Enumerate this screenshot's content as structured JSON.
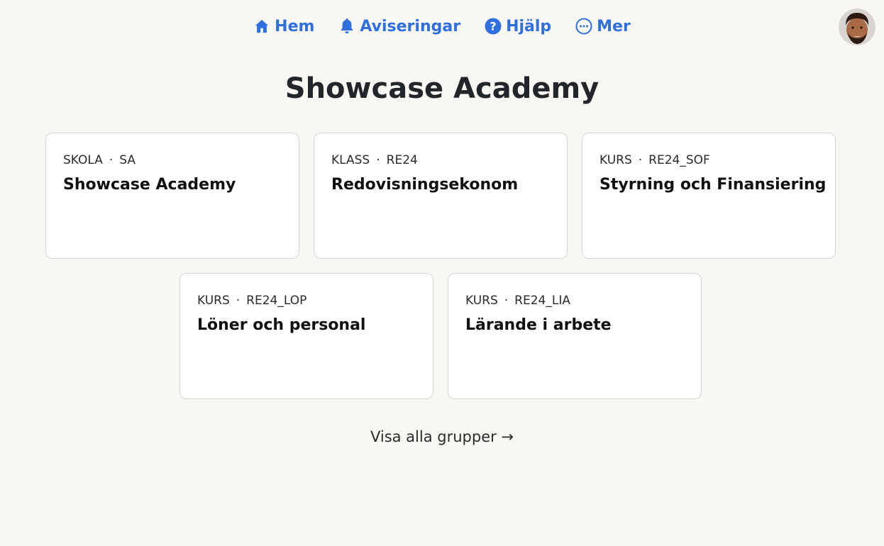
{
  "nav": {
    "items": [
      {
        "label": "Hem",
        "icon": "home-icon"
      },
      {
        "label": "Aviseringar",
        "icon": "bell-icon"
      },
      {
        "label": "Hjälp",
        "icon": "help-icon"
      },
      {
        "label": "Mer",
        "icon": "more-icon"
      }
    ],
    "accent_color": "#2f6fde"
  },
  "page": {
    "title": "Showcase Academy"
  },
  "cards": [
    {
      "type": "SKOLA",
      "separator": "·",
      "code": "SA",
      "title": "Showcase Academy"
    },
    {
      "type": "KLASS",
      "separator": "·",
      "code": "RE24",
      "title": "Redovisningsekonom"
    },
    {
      "type": "KURS",
      "separator": "·",
      "code": "RE24_SOF",
      "title": "Styrning och Finansiering"
    },
    {
      "type": "KURS",
      "separator": "·",
      "code": "RE24_LOP",
      "title": "Löner och personal"
    },
    {
      "type": "KURS",
      "separator": "·",
      "code": "RE24_LIA",
      "title": "Lärande i arbete"
    }
  ],
  "footer": {
    "show_all_label": "Visa alla grupper →"
  }
}
